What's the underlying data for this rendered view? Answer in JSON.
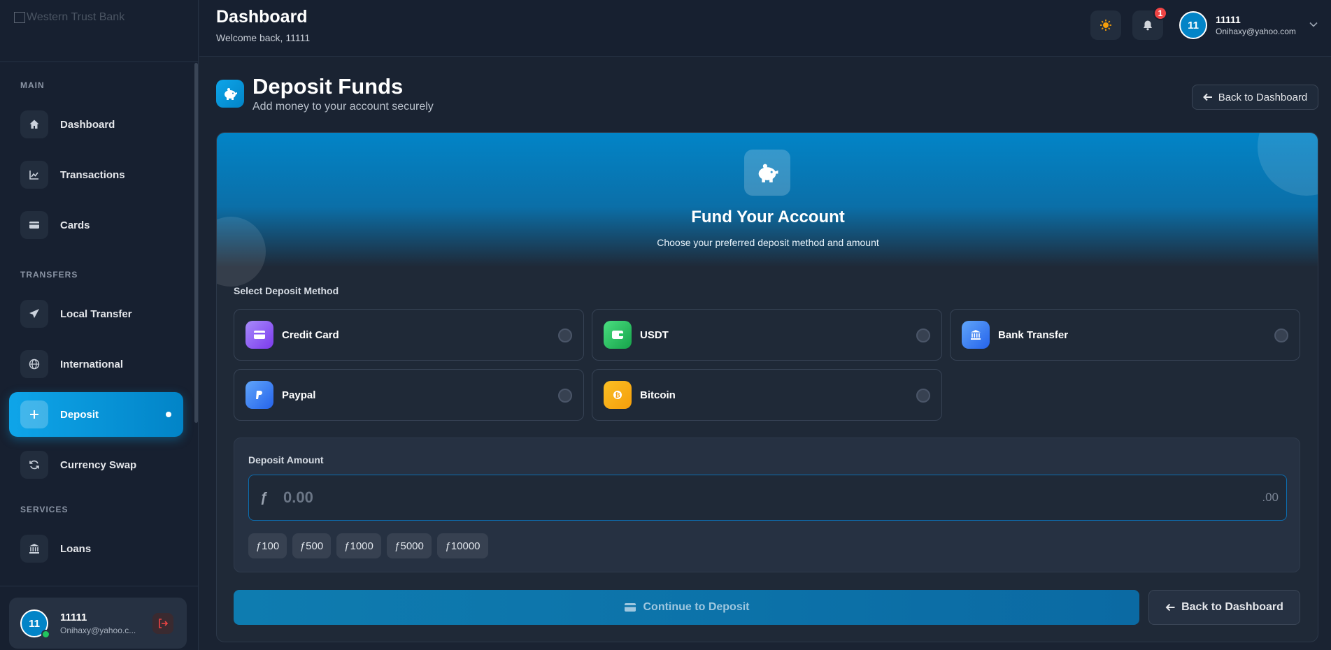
{
  "sidebar": {
    "logo_alt": "Western Trust Bank",
    "sections": {
      "main": "MAIN",
      "transfers": "TRANSFERS",
      "services": "SERVICES"
    },
    "items": [
      {
        "label": "Dashboard",
        "icon": "home-icon"
      },
      {
        "label": "Transactions",
        "icon": "chart-line-icon"
      },
      {
        "label": "Cards",
        "icon": "card-icon"
      },
      {
        "label": "Local Transfer",
        "icon": "paper-plane-icon"
      },
      {
        "label": "International",
        "icon": "globe-icon"
      },
      {
        "label": "Deposit",
        "icon": "plus-icon",
        "active": true
      },
      {
        "label": "Currency Swap",
        "icon": "refresh-icon"
      },
      {
        "label": "Loans",
        "icon": "bank-icon"
      }
    ],
    "user": {
      "initials": "11",
      "name": "11111",
      "email": "Onihaxy@yahoo.c..."
    }
  },
  "header": {
    "title": "Dashboard",
    "subtitle": "Welcome back, 11111",
    "notifications": "1",
    "user": {
      "initials": "11",
      "name": "11111",
      "email": "Onihaxy@yahoo.com"
    }
  },
  "page": {
    "title": "Deposit Funds",
    "subtitle": "Add money to your account securely",
    "back_label": "Back to Dashboard"
  },
  "hero": {
    "title": "Fund Your Account",
    "subtitle": "Choose your preferred deposit method and amount"
  },
  "methods": {
    "label": "Select Deposit Method",
    "items": [
      {
        "label": "Credit Card",
        "color": "#8b5cf6"
      },
      {
        "label": "USDT",
        "color": "#22c55e"
      },
      {
        "label": "Bank Transfer",
        "color": "#3b82f6"
      },
      {
        "label": "Paypal",
        "color": "#3b82f6"
      },
      {
        "label": "Bitcoin",
        "color": "#f59e0b"
      }
    ]
  },
  "amount": {
    "label": "Deposit Amount",
    "currency": "ƒ",
    "placeholder": "0.00",
    "suffix": ".00",
    "quick": [
      "ƒ100",
      "ƒ500",
      "ƒ1000",
      "ƒ5000",
      "ƒ10000"
    ]
  },
  "actions": {
    "continue_label": "Continue to Deposit",
    "back_label": "Back to Dashboard"
  },
  "colors": {
    "accent": "#0ea5e9",
    "background": "#1a2332",
    "danger": "#ef4444"
  }
}
